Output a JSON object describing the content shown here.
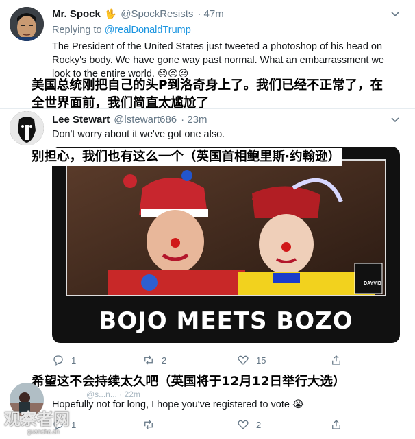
{
  "tweet1": {
    "name": "Mr. Spock",
    "badge_emoji": "🖖",
    "handle": "@SpockResists",
    "time": "· 47m",
    "reply_prefix": "Replying to",
    "reply_to": "@realDonaldTrump",
    "line1": "The President of the United States just tweeted a photoshop of his head on",
    "line2": "Rocky's body. We have gone way past normal. What an embarrassment we",
    "line3": "look to the entire world.",
    "emojis": "😔😔😔",
    "translation_line1": "美国总统刚把自己的头P到洛奇身上了。我们已经不正常了，在",
    "translation_line2": "全世界面前，我们简直太尴尬了"
  },
  "tweet2": {
    "name": "Lee Stewart",
    "handle": "@lstewart686",
    "time": "· 23m",
    "text": "Don't worry about it we've got one also.",
    "translation": "别担心，我们也有这么一个（英国首相鲍里斯·约翰逊）",
    "meme_caption": "BOJO MEETS BOZO",
    "meme_logo": "DAYVID",
    "actions": {
      "reply_count": "1",
      "retweet_count": "2",
      "like_count": "15"
    }
  },
  "tweet3": {
    "translation": "希望这不会持续太久吧（英国将于12月12日举行大选）",
    "handle_partial": "@s...n... · 22m",
    "text": "Hopefully not for long, I hope you've registered to vote",
    "emoji": "😭",
    "actions": {
      "reply_count": "1",
      "retweet_count": "",
      "like_count": "2"
    }
  },
  "watermark": {
    "main": "观察者网",
    "sub": "guancha.cn"
  },
  "colors": {
    "link": "#1b95e0",
    "secondary": "#657786",
    "meme_frame": "#111111"
  }
}
